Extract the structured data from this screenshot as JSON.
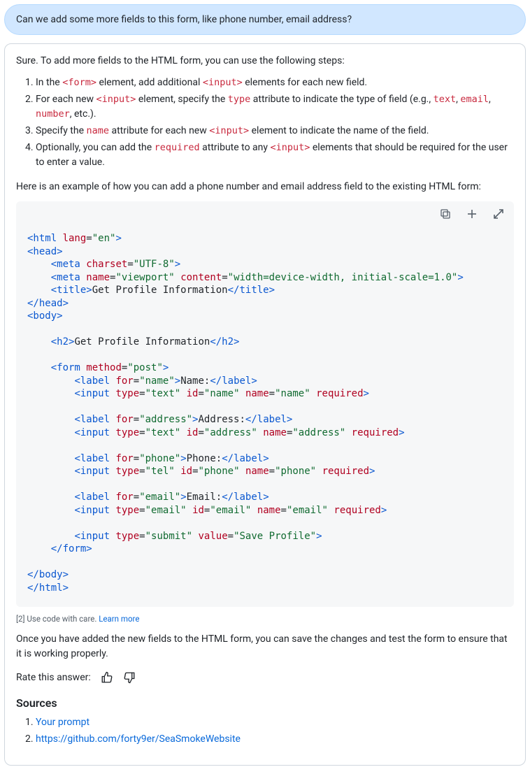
{
  "userMessage": "Can we add some more fields to this form, like phone number, email address?",
  "answer": {
    "intro": "Sure. To add more fields to the HTML form, you can use the following steps:",
    "steps": [
      {
        "segments": [
          {
            "t": "In the "
          },
          {
            "t": "<form>",
            "c": "kw-red",
            "mono": true
          },
          {
            "t": " element, add additional "
          },
          {
            "t": "<input>",
            "c": "kw-red",
            "mono": true
          },
          {
            "t": " elements for each new field."
          }
        ]
      },
      {
        "segments": [
          {
            "t": "For each new "
          },
          {
            "t": "<input>",
            "c": "kw-red",
            "mono": true
          },
          {
            "t": " element, specify the "
          },
          {
            "t": "type",
            "c": "kw-red",
            "mono": true
          },
          {
            "t": " attribute to indicate the type of field (e.g., "
          },
          {
            "t": "text",
            "c": "kw-red",
            "mono": true
          },
          {
            "t": ", "
          },
          {
            "t": "email",
            "c": "kw-red",
            "mono": true
          },
          {
            "t": ", "
          },
          {
            "t": "number",
            "c": "kw-red",
            "mono": true
          },
          {
            "t": ", etc.)."
          }
        ]
      },
      {
        "segments": [
          {
            "t": "Specify the "
          },
          {
            "t": "name",
            "c": "kw-red",
            "mono": true
          },
          {
            "t": " attribute for each new "
          },
          {
            "t": "<input>",
            "c": "kw-red",
            "mono": true
          },
          {
            "t": " element to indicate the name of the field."
          }
        ]
      },
      {
        "segments": [
          {
            "t": "Optionally, you can add the "
          },
          {
            "t": "required",
            "c": "kw-red",
            "mono": true
          },
          {
            "t": " attribute to any "
          },
          {
            "t": "<input>",
            "c": "kw-red",
            "mono": true
          },
          {
            "t": " elements that should be required for the user to enter a value."
          }
        ]
      }
    ],
    "example_lead": "Here is an example of how you can add a phone number and email address field to the existing HTML form:",
    "code_tokens": [
      [
        {
          "t": "<html ",
          "c": "tag"
        },
        {
          "t": "lang",
          "c": "attr"
        },
        {
          "t": "=",
          "c": "txt"
        },
        {
          "t": "\"en\"",
          "c": "val"
        },
        {
          "t": ">",
          "c": "tag"
        }
      ],
      [
        {
          "t": "<head>",
          "c": "tag"
        }
      ],
      [
        {
          "t": "    "
        },
        {
          "t": "<meta ",
          "c": "tag"
        },
        {
          "t": "charset",
          "c": "attr"
        },
        {
          "t": "=",
          "c": "txt"
        },
        {
          "t": "\"UTF-8\"",
          "c": "val"
        },
        {
          "t": ">",
          "c": "tag"
        }
      ],
      [
        {
          "t": "    "
        },
        {
          "t": "<meta ",
          "c": "tag"
        },
        {
          "t": "name",
          "c": "attr"
        },
        {
          "t": "=",
          "c": "txt"
        },
        {
          "t": "\"viewport\"",
          "c": "val"
        },
        {
          "t": " "
        },
        {
          "t": "content",
          "c": "attr"
        },
        {
          "t": "=",
          "c": "txt"
        },
        {
          "t": "\"width=device-width, initial-scale=1.0\"",
          "c": "val"
        },
        {
          "t": ">",
          "c": "tag"
        }
      ],
      [
        {
          "t": "    "
        },
        {
          "t": "<title>",
          "c": "tag"
        },
        {
          "t": "Get Profile Information",
          "c": "txt"
        },
        {
          "t": "</title>",
          "c": "tag"
        }
      ],
      [
        {
          "t": "</head>",
          "c": "tag"
        }
      ],
      [
        {
          "t": "<body>",
          "c": "tag"
        }
      ],
      [
        {
          "t": ""
        }
      ],
      [
        {
          "t": "    "
        },
        {
          "t": "<h2>",
          "c": "tag"
        },
        {
          "t": "Get Profile Information",
          "c": "txt"
        },
        {
          "t": "</h2>",
          "c": "tag"
        }
      ],
      [
        {
          "t": ""
        }
      ],
      [
        {
          "t": "    "
        },
        {
          "t": "<form ",
          "c": "tag"
        },
        {
          "t": "method",
          "c": "attr"
        },
        {
          "t": "=",
          "c": "txt"
        },
        {
          "t": "\"post\"",
          "c": "val"
        },
        {
          "t": ">",
          "c": "tag"
        }
      ],
      [
        {
          "t": "        "
        },
        {
          "t": "<label ",
          "c": "tag"
        },
        {
          "t": "for",
          "c": "attr"
        },
        {
          "t": "=",
          "c": "txt"
        },
        {
          "t": "\"name\"",
          "c": "val"
        },
        {
          "t": ">",
          "c": "tag"
        },
        {
          "t": "Name:",
          "c": "txt"
        },
        {
          "t": "</label>",
          "c": "tag"
        }
      ],
      [
        {
          "t": "        "
        },
        {
          "t": "<input ",
          "c": "tag"
        },
        {
          "t": "type",
          "c": "attr"
        },
        {
          "t": "=",
          "c": "txt"
        },
        {
          "t": "\"text\"",
          "c": "val"
        },
        {
          "t": " "
        },
        {
          "t": "id",
          "c": "attr"
        },
        {
          "t": "=",
          "c": "txt"
        },
        {
          "t": "\"name\"",
          "c": "val"
        },
        {
          "t": " "
        },
        {
          "t": "name",
          "c": "attr"
        },
        {
          "t": "=",
          "c": "txt"
        },
        {
          "t": "\"name\"",
          "c": "val"
        },
        {
          "t": " "
        },
        {
          "t": "required",
          "c": "attr"
        },
        {
          "t": ">",
          "c": "tag"
        }
      ],
      [
        {
          "t": ""
        }
      ],
      [
        {
          "t": "        "
        },
        {
          "t": "<label ",
          "c": "tag"
        },
        {
          "t": "for",
          "c": "attr"
        },
        {
          "t": "=",
          "c": "txt"
        },
        {
          "t": "\"address\"",
          "c": "val"
        },
        {
          "t": ">",
          "c": "tag"
        },
        {
          "t": "Address:",
          "c": "txt"
        },
        {
          "t": "</label>",
          "c": "tag"
        }
      ],
      [
        {
          "t": "        "
        },
        {
          "t": "<input ",
          "c": "tag"
        },
        {
          "t": "type",
          "c": "attr"
        },
        {
          "t": "=",
          "c": "txt"
        },
        {
          "t": "\"text\"",
          "c": "val"
        },
        {
          "t": " "
        },
        {
          "t": "id",
          "c": "attr"
        },
        {
          "t": "=",
          "c": "txt"
        },
        {
          "t": "\"address\"",
          "c": "val"
        },
        {
          "t": " "
        },
        {
          "t": "name",
          "c": "attr"
        },
        {
          "t": "=",
          "c": "txt"
        },
        {
          "t": "\"address\"",
          "c": "val"
        },
        {
          "t": " "
        },
        {
          "t": "required",
          "c": "attr"
        },
        {
          "t": ">",
          "c": "tag"
        }
      ],
      [
        {
          "t": ""
        }
      ],
      [
        {
          "t": "        "
        },
        {
          "t": "<label ",
          "c": "tag"
        },
        {
          "t": "for",
          "c": "attr"
        },
        {
          "t": "=",
          "c": "txt"
        },
        {
          "t": "\"phone\"",
          "c": "val"
        },
        {
          "t": ">",
          "c": "tag"
        },
        {
          "t": "Phone:",
          "c": "txt"
        },
        {
          "t": "</label>",
          "c": "tag"
        }
      ],
      [
        {
          "t": "        "
        },
        {
          "t": "<input ",
          "c": "tag"
        },
        {
          "t": "type",
          "c": "attr"
        },
        {
          "t": "=",
          "c": "txt"
        },
        {
          "t": "\"tel\"",
          "c": "val"
        },
        {
          "t": " "
        },
        {
          "t": "id",
          "c": "attr"
        },
        {
          "t": "=",
          "c": "txt"
        },
        {
          "t": "\"phone\"",
          "c": "val"
        },
        {
          "t": " "
        },
        {
          "t": "name",
          "c": "attr"
        },
        {
          "t": "=",
          "c": "txt"
        },
        {
          "t": "\"phone\"",
          "c": "val"
        },
        {
          "t": " "
        },
        {
          "t": "required",
          "c": "attr"
        },
        {
          "t": ">",
          "c": "tag"
        }
      ],
      [
        {
          "t": ""
        }
      ],
      [
        {
          "t": "        "
        },
        {
          "t": "<label ",
          "c": "tag"
        },
        {
          "t": "for",
          "c": "attr"
        },
        {
          "t": "=",
          "c": "txt"
        },
        {
          "t": "\"email\"",
          "c": "val"
        },
        {
          "t": ">",
          "c": "tag"
        },
        {
          "t": "Email:",
          "c": "txt"
        },
        {
          "t": "</label>",
          "c": "tag"
        }
      ],
      [
        {
          "t": "        "
        },
        {
          "t": "<input ",
          "c": "tag"
        },
        {
          "t": "type",
          "c": "attr"
        },
        {
          "t": "=",
          "c": "txt"
        },
        {
          "t": "\"email\"",
          "c": "val"
        },
        {
          "t": " "
        },
        {
          "t": "id",
          "c": "attr"
        },
        {
          "t": "=",
          "c": "txt"
        },
        {
          "t": "\"email\"",
          "c": "val"
        },
        {
          "t": " "
        },
        {
          "t": "name",
          "c": "attr"
        },
        {
          "t": "=",
          "c": "txt"
        },
        {
          "t": "\"email\"",
          "c": "val"
        },
        {
          "t": " "
        },
        {
          "t": "required",
          "c": "attr"
        },
        {
          "t": ">",
          "c": "tag"
        }
      ],
      [
        {
          "t": ""
        }
      ],
      [
        {
          "t": "        "
        },
        {
          "t": "<input ",
          "c": "tag"
        },
        {
          "t": "type",
          "c": "attr"
        },
        {
          "t": "=",
          "c": "txt"
        },
        {
          "t": "\"submit\"",
          "c": "val"
        },
        {
          "t": " "
        },
        {
          "t": "value",
          "c": "attr"
        },
        {
          "t": "=",
          "c": "txt"
        },
        {
          "t": "\"Save Profile\"",
          "c": "val"
        },
        {
          "t": ">",
          "c": "tag"
        }
      ],
      [
        {
          "t": "    "
        },
        {
          "t": "</form>",
          "c": "tag"
        }
      ],
      [
        {
          "t": ""
        }
      ],
      [
        {
          "t": "</body>",
          "c": "tag"
        }
      ],
      [
        {
          "t": "</html>",
          "c": "tag"
        }
      ]
    ],
    "warning_ref": "[2]",
    "warning_text": "Use code with care.",
    "warning_link": "Learn more",
    "outro": "Once you have added the new fields to the HTML form, you can save the changes and test the form to ensure that it is working properly.",
    "rate_label": "Rate this answer:",
    "sources_heading": "Sources",
    "sources": [
      {
        "label": "Your prompt"
      },
      {
        "label": "https://github.com/forty9er/SeaSmokeWebsite"
      }
    ]
  }
}
